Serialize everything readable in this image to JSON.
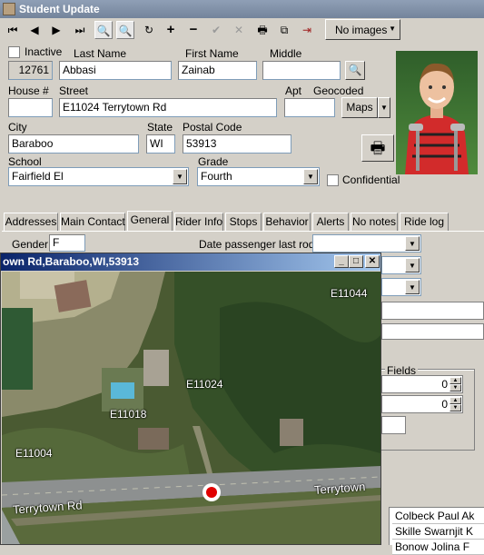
{
  "window": {
    "title": "Student Update"
  },
  "toolbar": {
    "buttons": [
      {
        "name": "first-record-button",
        "glyph": "⏮"
      },
      {
        "name": "prev-record-button",
        "glyph": "◀"
      },
      {
        "name": "next-record-button",
        "glyph": "▶"
      },
      {
        "name": "last-record-button",
        "glyph": "⏭"
      },
      {
        "name": "find-button",
        "glyph": "🔍"
      },
      {
        "name": "find-next-button",
        "glyph": "🔍"
      },
      {
        "name": "refresh-button",
        "glyph": "↻"
      },
      {
        "name": "add-record-button",
        "glyph": "+"
      },
      {
        "name": "delete-record-button",
        "glyph": "−"
      },
      {
        "name": "post-button",
        "glyph": "✔"
      },
      {
        "name": "cancel-button",
        "glyph": "✕"
      },
      {
        "name": "print-button",
        "glyph": "🖶"
      },
      {
        "name": "copy-button",
        "glyph": "⧉"
      },
      {
        "name": "exit-button",
        "glyph": "⇥"
      }
    ],
    "images_select": "No images"
  },
  "student": {
    "inactive_label": "Inactive",
    "id": "12761",
    "last_name_label": "Last Name",
    "last_name": "Abbasi",
    "first_name_label": "First Name",
    "first_name": "Zainab",
    "middle_label": "Middle",
    "middle": "",
    "house_label": "House #",
    "house": "",
    "street_label": "Street",
    "street": "E11024 Terrytown Rd",
    "apt_label": "Apt",
    "apt": "",
    "geocoded_label": "Geocoded",
    "maps_button": "Maps",
    "city_label": "City",
    "city": "Baraboo",
    "state_label": "State",
    "state": "WI",
    "postal_label": "Postal Code",
    "postal": "53913",
    "school_label": "School",
    "school": "Fairfield El",
    "grade_label": "Grade",
    "grade": "Fourth",
    "confidential_label": "Confidential"
  },
  "tabs": [
    "Addresses",
    "Main Contact",
    "General",
    "Rider Info",
    "Stops",
    "Behavior",
    "Alerts",
    "No notes",
    "Ride log"
  ],
  "active_tab": "General",
  "general": {
    "gender_label": "Gender",
    "gender": "F",
    "date_last_rode_label": "Date passenger last rode",
    "date_last_rode": "",
    "fields_label": "Fields",
    "spin1": "0",
    "spin2": "0"
  },
  "list": [
    "Colbeck Paul Ak",
    "Skille Swarnjit K",
    "Bonow Jolina F"
  ],
  "map_popup": {
    "title": "own Rd,Baraboo,WI,53913",
    "labels": [
      "E11044",
      "E11024",
      "E11018",
      "E11004",
      "Terrytown Rd",
      "Terrytown"
    ],
    "marker_color": "#e00000"
  }
}
